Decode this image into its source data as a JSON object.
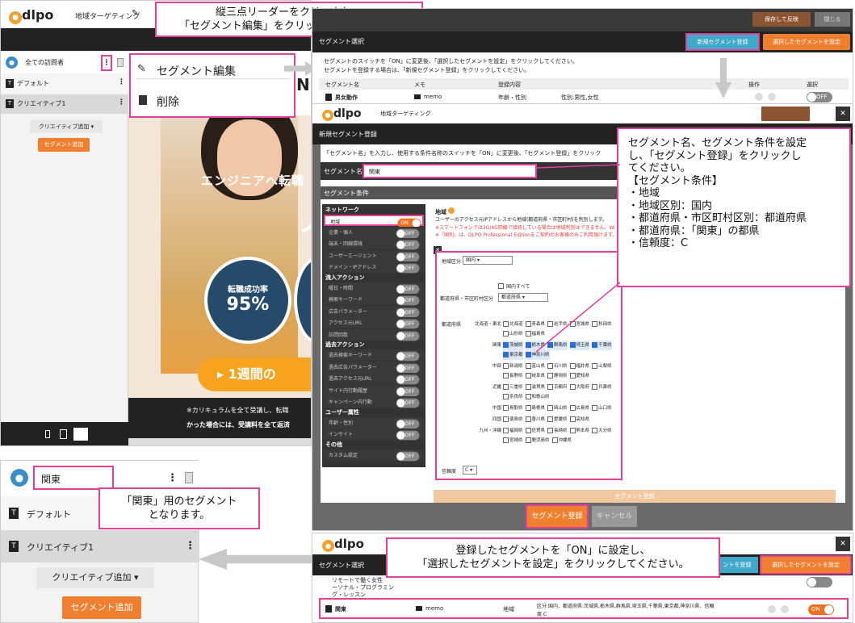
{
  "left_app": {
    "logo": "dlpo",
    "title": "地域ターゲティング",
    "segments": [
      {
        "label": "全ての訪問者",
        "active": true
      },
      {
        "label": "デフォルト"
      },
      {
        "label": "クリエイティブ1"
      }
    ],
    "add_creative": "クリエイティブ追加",
    "add_segment": "セグメント追加",
    "context_menu": {
      "edit": "セグメント編集",
      "delete": "削除"
    }
  },
  "ad": {
    "headline": "エンジニアへ転職",
    "stat_label": "転職成功率",
    "stat_value": "95%",
    "cta": "1週間の",
    "footnote1": "※カリキュラムを全て受講し、転職",
    "footnote2": "かった場合には、受講料を全て返済",
    "big_letter": "ノ",
    "big_n": "NI"
  },
  "callouts": {
    "c1_line1": "縦三点リーダーをクリックし、",
    "c1_line2": "「セグメント編集」をクリックしてください。",
    "c2_lines": [
      "セグメント名、セグメント条件を設定",
      "し、「セグメント登録」をクリックし",
      "てください。",
      "【セグメント条件】",
      "・地域",
      "・地域区別：国内",
      "・都道府県・市区町村区別：都道府県",
      "・都道府県：「関東」の都県",
      "・信頼度：C"
    ],
    "c3_line1": "「関東」用のセグメント",
    "c3_line2": "となります。",
    "c4_line1": "登録したセグメントを「ON」に設定し、",
    "c4_line2": "「選択したセグメントを設定」をクリックしてください。"
  },
  "top_modal": {
    "header": "セグメント選択",
    "btn_new": "新規セグメント登録",
    "btn_set": "選択したセグメントを設定",
    "note1": "セグメントのスイッチを「ON」に変更後、「選択したセグメントを設定」をクリックしてください。",
    "note2": "セグメントを登録する場合は、「新規セグメント登録」をクリックしてください。",
    "cols": [
      "セグメント名",
      "メモ",
      "登録内容",
      "操作",
      "選択"
    ],
    "row": {
      "name": "男女動作",
      "memo": "memo",
      "content": "年齢・性別",
      "detail": "性別:男性,女性",
      "toggle": "OFF"
    },
    "btn_save": "保存して反映",
    "btn_close": "閉じる"
  },
  "mid_modal": {
    "logo": "dlpo",
    "title": "地域ターゲティング",
    "header": "新規セグメント登録",
    "instruction": "「セグメント名」を入力し、使用する条件名称のスイッチを「ON」に変更後、「セグメント登録」をクリック",
    "name_label": "セグメント名",
    "name_value": "関東",
    "cond_header": "セグメント条件",
    "groups": [
      {
        "title": "ネットワーク",
        "items": [
          [
            "地域",
            "ON"
          ],
          [
            "企業・個人",
            "OFF"
          ],
          [
            "端末・回線環境",
            "OFF"
          ],
          [
            "ユーザーエージェント",
            "OFF"
          ],
          [
            "ドメイン・IPアドレス",
            "OFF"
          ]
        ]
      },
      {
        "title": "流入アクション",
        "items": [
          [
            "曜日・時間",
            "OFF"
          ],
          [
            "検索キーワード",
            "OFF"
          ],
          [
            "広告パラメーター",
            "OFF"
          ],
          [
            "アクセス元URL",
            "OFF"
          ],
          [
            "訪問回数",
            "OFF"
          ]
        ]
      },
      {
        "title": "過去アクション",
        "items": [
          [
            "過去検索キーワード",
            "OFF"
          ],
          [
            "過去広告パラメーター",
            "OFF"
          ],
          [
            "過去アクセス元URL",
            "OFF"
          ],
          [
            "サイト内行動履歴",
            "OFF"
          ],
          [
            "キャンペーン内行動",
            "OFF"
          ]
        ]
      },
      {
        "title": "ユーザー属性",
        "items": [
          [
            "年齢・性別",
            "OFF"
          ],
          [
            "インサイト",
            "OFF"
          ]
        ]
      },
      {
        "title": "その他",
        "items": [
          [
            "カスタム設定",
            "OFF"
          ]
        ]
      }
    ],
    "region_title": "地域",
    "region_desc": "ユーザーのアクセス元IPアドレスから地域(都道府県・市区町村)を判別します。",
    "region_warn1": "※スマートフォンでは3G/4G回線で接続している場合は地域判別はできません。Wi",
    "region_warn2": "※「国別」は、DLPO Professional Editionをご契約のお客様のみご利用頂けます。",
    "area_label": "地域区分",
    "area_value": "国内",
    "all_domestic": "国内すべて",
    "pref_mode_label": "都道府県・市区町村区分",
    "pref_mode_value": "都道府県",
    "pref_label": "都道府県",
    "regions": [
      {
        "name": "北海道・東北",
        "prefs": [
          [
            "北海道",
            0
          ],
          [
            "青森県",
            0
          ],
          [
            "岩手県",
            0
          ],
          [
            "宮城県",
            0
          ],
          [
            "秋田県",
            0
          ],
          [
            "山形県",
            0
          ],
          [
            "福島県",
            0
          ]
        ]
      },
      {
        "name": "関東",
        "prefs": [
          [
            "茨城県",
            1
          ],
          [
            "栃木県",
            1
          ],
          [
            "群馬県",
            1
          ],
          [
            "埼玉県",
            1
          ],
          [
            "千葉県",
            1
          ],
          [
            "東京都",
            1
          ],
          [
            "神奈川県",
            1
          ]
        ]
      },
      {
        "name": "中部",
        "prefs": [
          [
            "新潟県",
            0
          ],
          [
            "富山県",
            0
          ],
          [
            "石川県",
            0
          ],
          [
            "福井県",
            0
          ],
          [
            "山梨県",
            0
          ],
          [
            "長野県",
            0
          ],
          [
            "岐阜県",
            0
          ],
          [
            "静岡県",
            0
          ],
          [
            "愛知県",
            0
          ]
        ]
      },
      {
        "name": "近畿",
        "prefs": [
          [
            "三重県",
            0
          ],
          [
            "滋賀県",
            0
          ],
          [
            "京都府",
            0
          ],
          [
            "大阪府",
            0
          ],
          [
            "兵庫県",
            0
          ],
          [
            "奈良県",
            0
          ],
          [
            "和歌山県",
            0
          ]
        ]
      },
      {
        "name": "中国",
        "prefs": [
          [
            "鳥取県",
            0
          ],
          [
            "島根県",
            0
          ],
          [
            "岡山県",
            0
          ],
          [
            "広島県",
            0
          ],
          [
            "山口県",
            0
          ]
        ]
      },
      {
        "name": "四国",
        "prefs": [
          [
            "徳島県",
            0
          ],
          [
            "香川県",
            0
          ],
          [
            "愛媛県",
            0
          ],
          [
            "高知県",
            0
          ]
        ]
      },
      {
        "name": "九州・沖縄",
        "prefs": [
          [
            "福岡県",
            0
          ],
          [
            "佐賀県",
            0
          ],
          [
            "長崎県",
            0
          ],
          [
            "熊本県",
            0
          ],
          [
            "大分県",
            0
          ],
          [
            "宮崎県",
            0
          ],
          [
            "鹿児島県",
            0
          ],
          [
            "沖縄県",
            0
          ]
        ]
      }
    ],
    "reliability_label": "信頼度",
    "reliability_value": "C",
    "inner_submit": "セグメント登録",
    "btn_register": "セグメント登録",
    "btn_cancel": "キャンセル"
  },
  "bottom_left": {
    "segment_name": "関東",
    "default_label": "デフォルト",
    "creative_label": "クリエイティブ1",
    "add_creative": "クリエイティブ追加",
    "add_segment": "セグメント追加"
  },
  "bottom_modal": {
    "logo": "dlpo",
    "header": "セグメント選択",
    "btn_new": "ントを登録",
    "btn_set": "選択したセグメントを設定",
    "row1_lines": [
      "リモートで働く女性",
      "ーソナル・プログラミン",
      "グ・レッスン"
    ],
    "row2_name": "関東",
    "row2_memo": "memo",
    "row2_content": "地域",
    "row2_detail1": "区分:国内、都道府県:茨城県,栃木県,群馬県,埼玉県,千葉県,東京都,神奈川県、信頼",
    "row2_detail2": "度:C",
    "row2_toggle": "ON"
  }
}
